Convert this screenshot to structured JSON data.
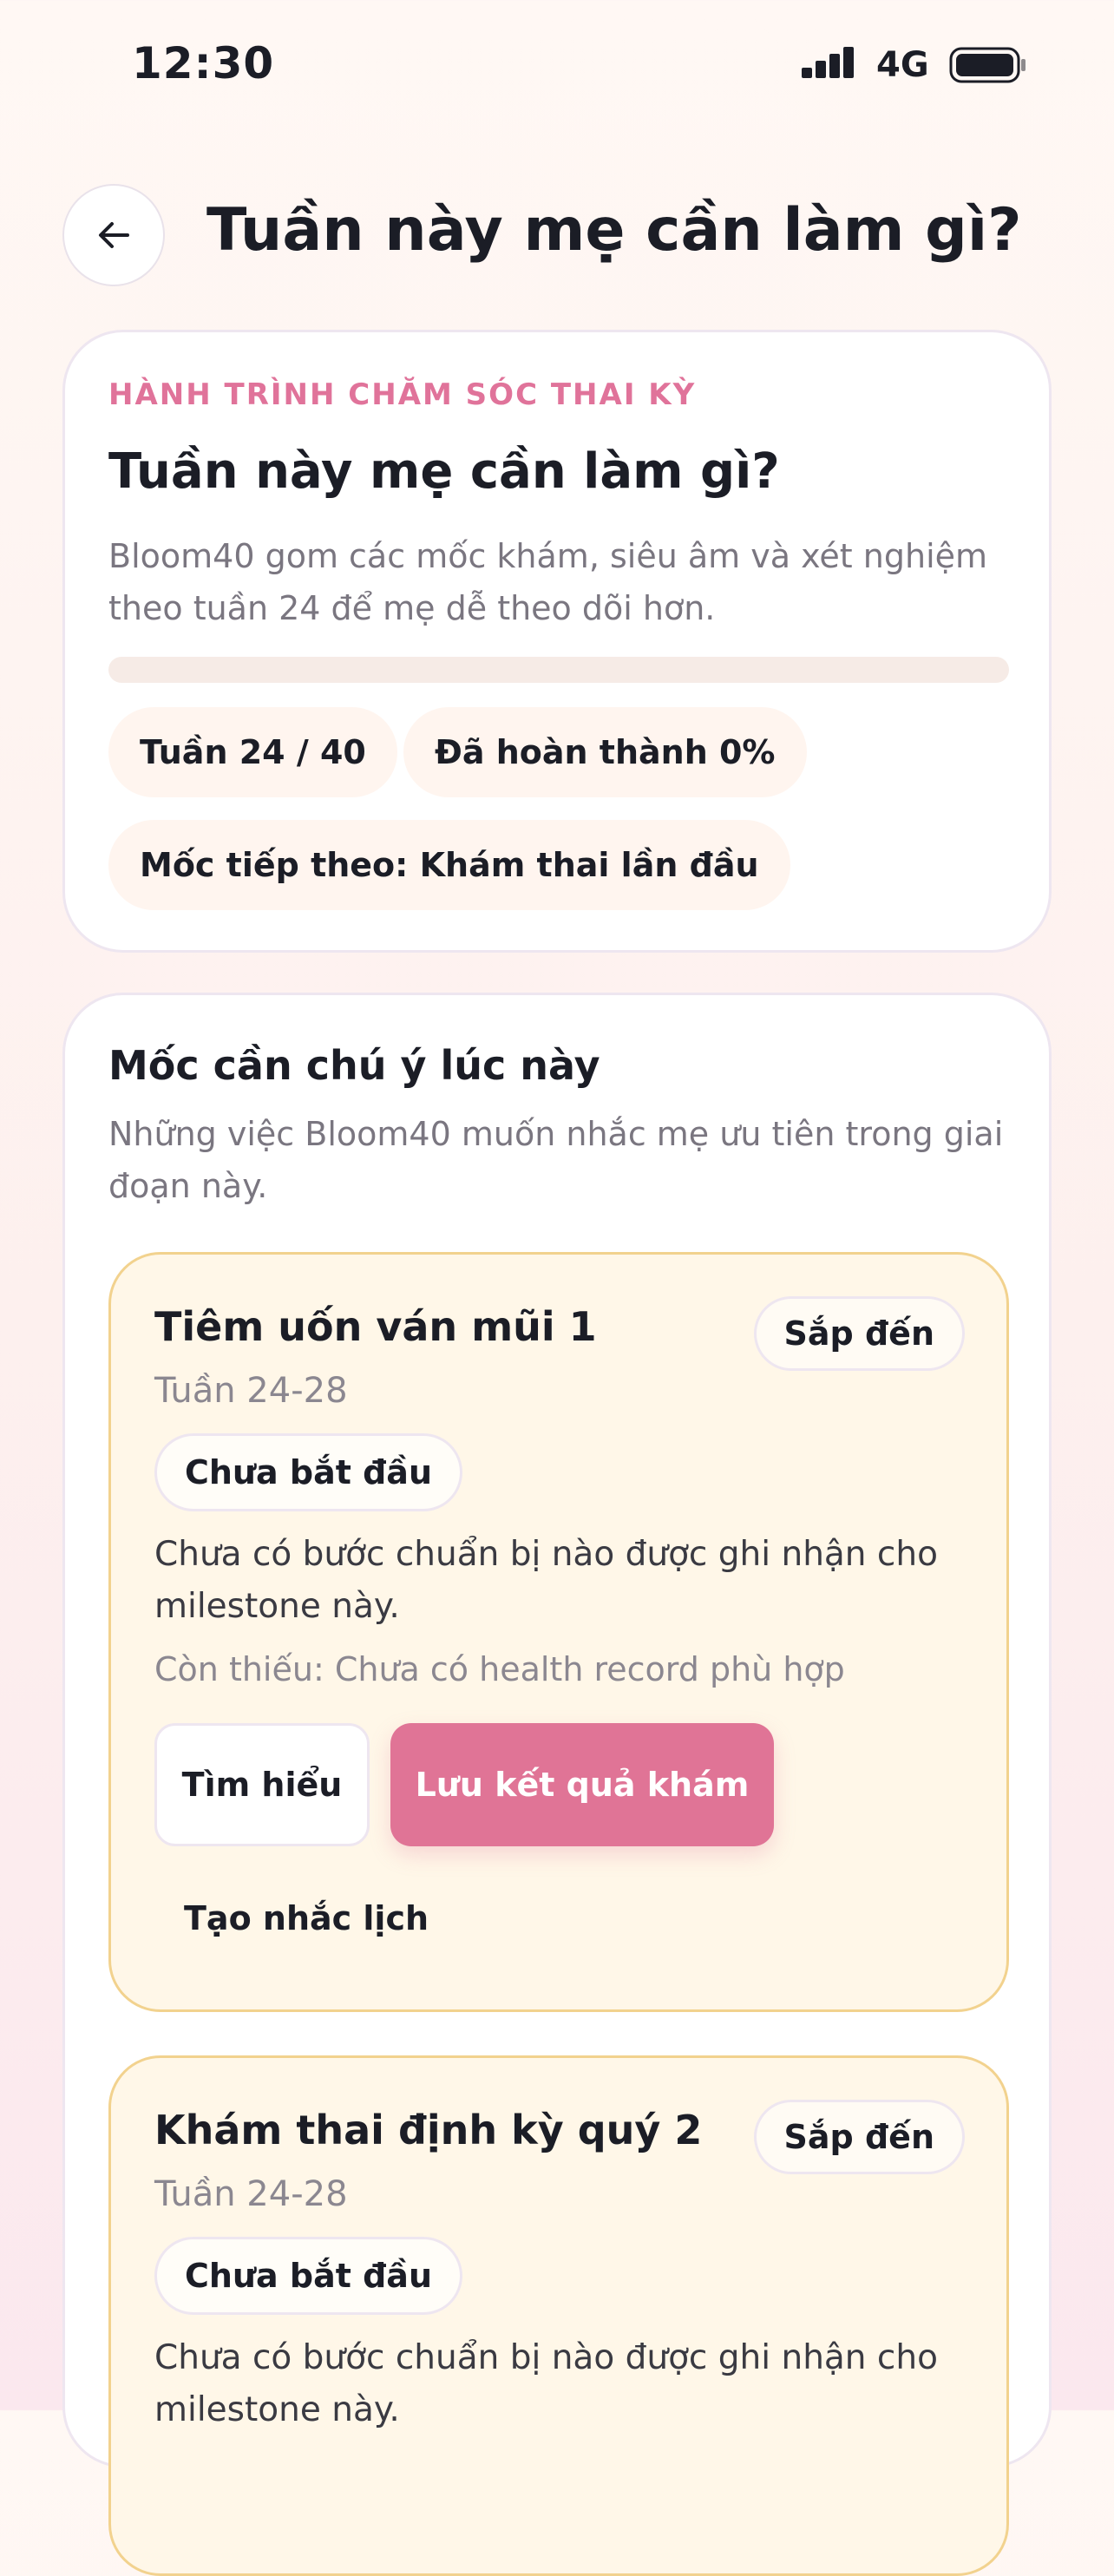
{
  "status_bar": {
    "time": "12:30",
    "network": "4G"
  },
  "header": {
    "title": "Tuần này mẹ cần làm gì?"
  },
  "hero": {
    "eyebrow": "HÀNH TRÌNH CHĂM SÓC THAI KỲ",
    "title": "Tuần này mẹ cần làm gì?",
    "description": "Bloom40 gom các mốc khám, siêu âm và xét nghiệm theo tuần 24 để mẹ dễ theo dõi hơn.",
    "progress_percent": 0,
    "chips": {
      "week": "Tuần 24 / 40",
      "completed": "Đã hoàn thành 0%",
      "next": "Mốc tiếp theo: Khám thai lần đầu"
    }
  },
  "milestones_section": {
    "title": "Mốc cần chú ý lúc này",
    "description": "Những việc Bloom40 muốn nhắc mẹ ưu tiên trong giai đoạn này.",
    "items": [
      {
        "title": "Tiêm uốn ván mũi 1",
        "week": "Tuần 24-28",
        "badge": "Sắp đến",
        "state": "Chưa bắt đầu",
        "description": "Chưa có bước chuẩn bị nào được ghi nhận cho milestone này.",
        "missing": "Còn thiếu: Chưa có health record phù hợp",
        "learn_label": "Tìm hiểu",
        "save_label": "Lưu kết quả khám",
        "remind_label": "Tạo nhắc lịch"
      },
      {
        "title": "Khám thai định kỳ quý 2",
        "week": "Tuần 24-28",
        "badge": "Sắp đến",
        "state": "Chưa bắt đầu",
        "description": "Chưa có bước chuẩn bị nào được ghi nhận cho milestone này."
      }
    ]
  },
  "colors": {
    "accent": "#E07496",
    "eyebrow": "#E0739A",
    "milestone_bg": "#FFF7E8",
    "milestone_border": "#F2D28E"
  },
  "icons": {
    "back": "arrow-left-icon",
    "signal": "cellular-signal-icon",
    "battery": "battery-icon"
  }
}
